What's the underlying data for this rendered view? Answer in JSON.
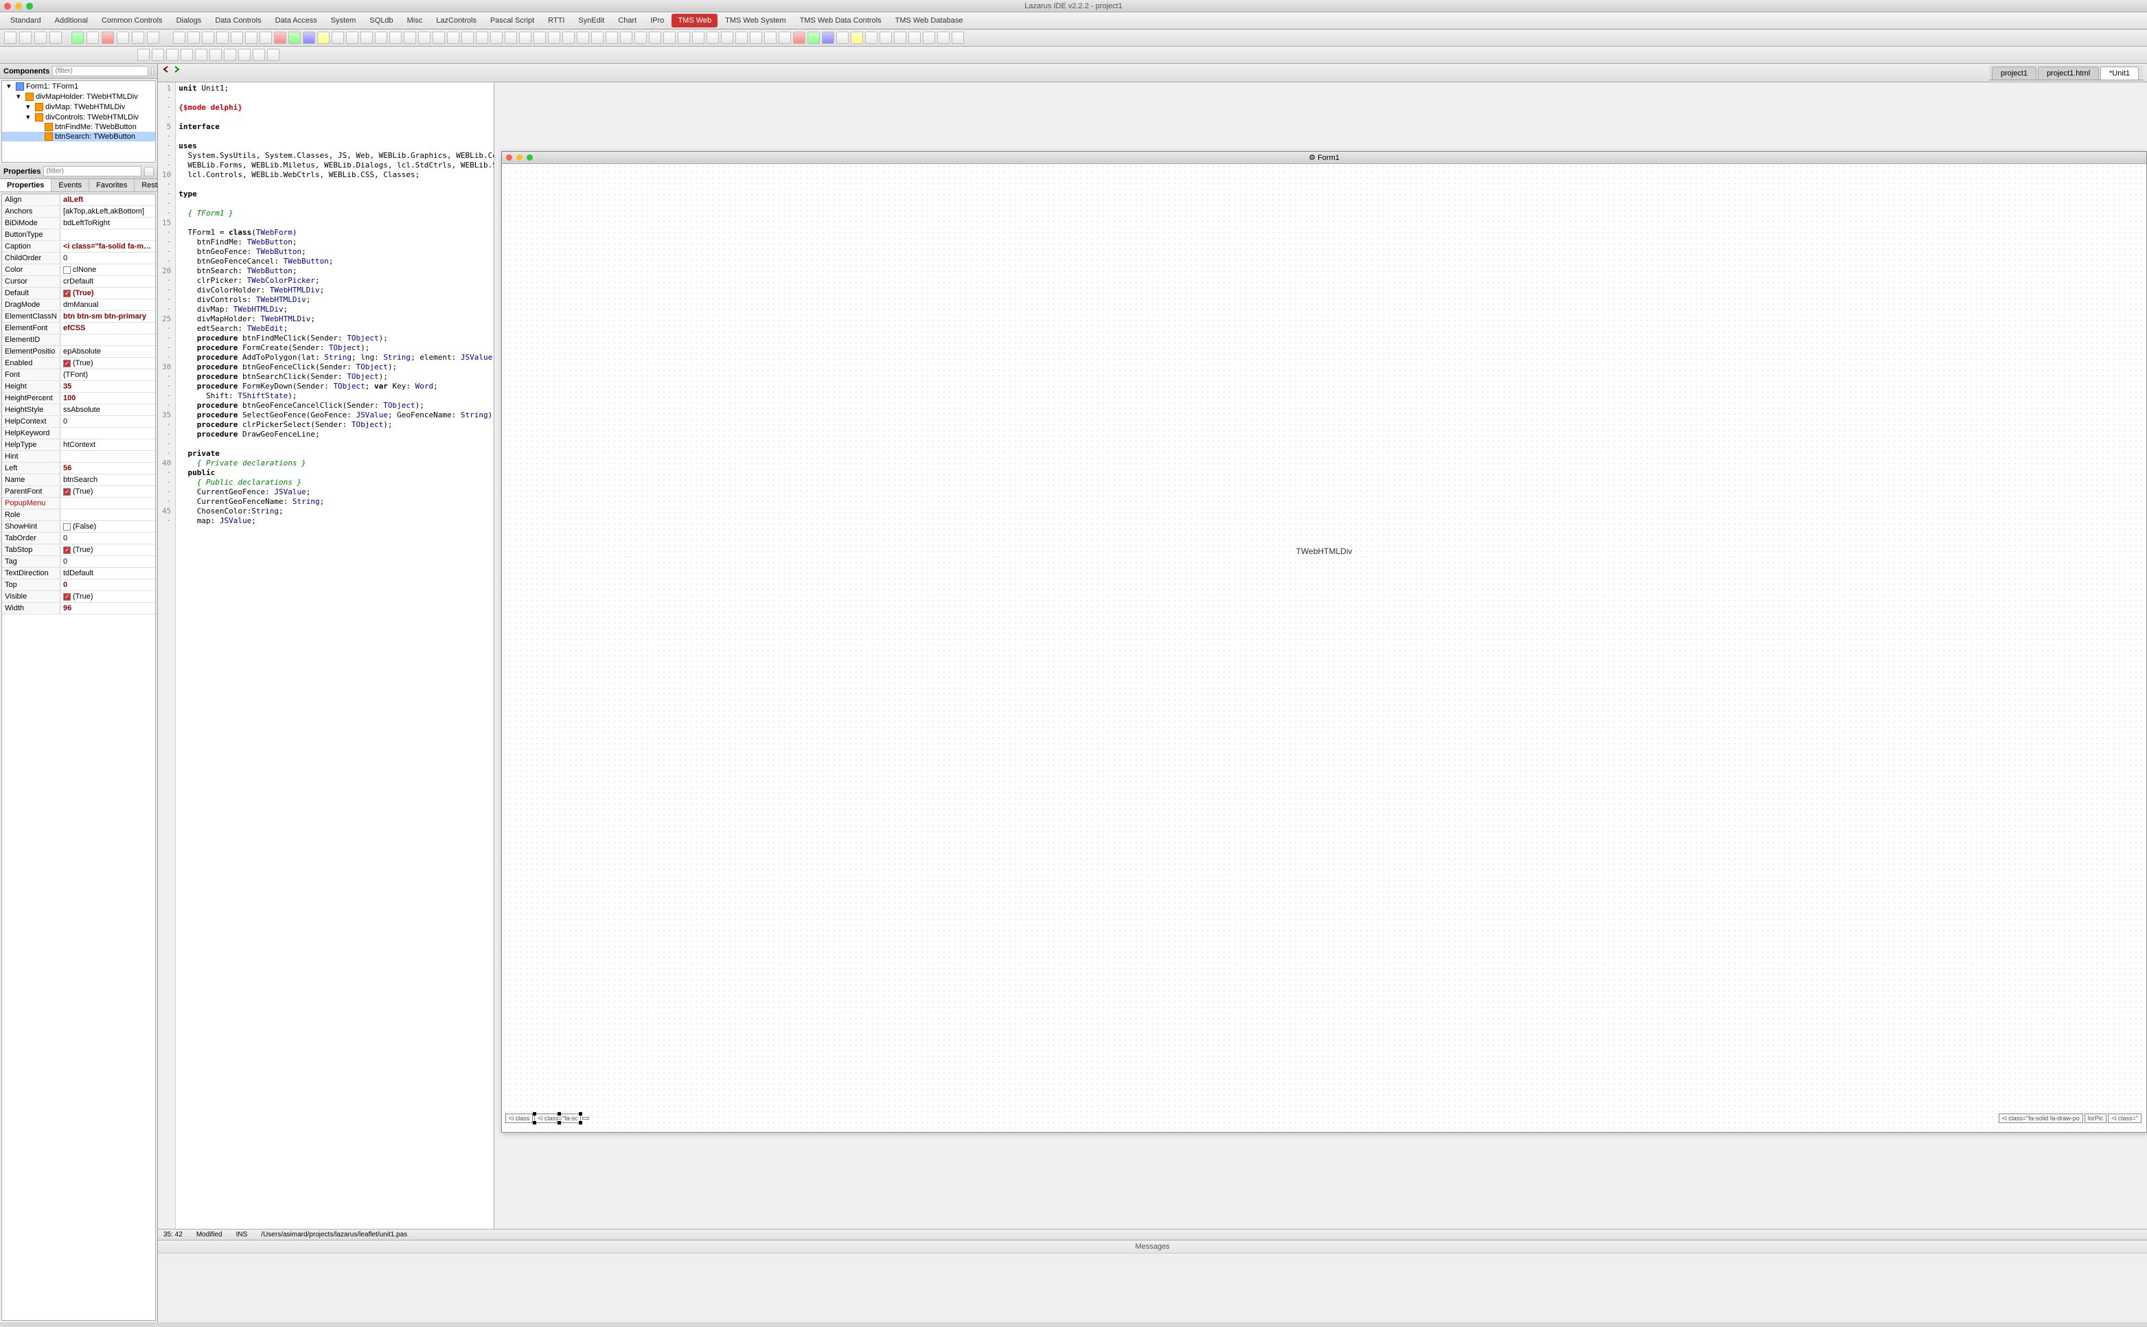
{
  "app": {
    "title": "Lazarus IDE v2.2.2 - project1"
  },
  "componentTabs": [
    "Standard",
    "Additional",
    "Common Controls",
    "Dialogs",
    "Data Controls",
    "Data Access",
    "System",
    "SQLdb",
    "Misc",
    "LazControls",
    "Pascal Script",
    "RTTI",
    "SynEdit",
    "Chart",
    "IPro",
    "TMS Web",
    "TMS Web System",
    "TMS Web Data Controls",
    "TMS Web Database"
  ],
  "componentTabActive": "TMS Web",
  "componentsPanel": {
    "title": "Components",
    "filterPlaceholder": "(filter)",
    "tree": [
      {
        "indent": 0,
        "label": "Form1: TForm1",
        "icon": "form"
      },
      {
        "indent": 1,
        "label": "divMapHolder: TWebHTMLDiv",
        "icon": "comp"
      },
      {
        "indent": 2,
        "label": "divMap: TWebHTMLDiv",
        "icon": "comp"
      },
      {
        "indent": 2,
        "label": "divControls: TWebHTMLDiv",
        "icon": "comp"
      },
      {
        "indent": 3,
        "label": "btnFindMe: TWebButton",
        "icon": "comp"
      },
      {
        "indent": 3,
        "label": "btnSearch: TWebButton",
        "icon": "comp",
        "selected": true
      }
    ]
  },
  "propertiesPanel": {
    "title": "Properties",
    "filterPlaceholder": "(filter)",
    "tabs": [
      "Properties",
      "Events",
      "Favorites",
      "Restricted"
    ],
    "activeTab": "Properties",
    "rows": [
      {
        "name": "Align",
        "value": "alLeft",
        "bold": true
      },
      {
        "name": "Anchors",
        "value": "[akTop,akLeft,akBottom]"
      },
      {
        "name": "BiDiMode",
        "value": "bdLeftToRight"
      },
      {
        "name": "ButtonType",
        "value": ""
      },
      {
        "name": "Caption",
        "value": "<i class=\"fa-solid fa-magnifyir",
        "bold": true
      },
      {
        "name": "ChildOrder",
        "value": "0"
      },
      {
        "name": "Color",
        "value": "clNone",
        "check": false
      },
      {
        "name": "Cursor",
        "value": "crDefault"
      },
      {
        "name": "Default",
        "value": "(True)",
        "check": true,
        "bold": true
      },
      {
        "name": "DragMode",
        "value": "dmManual"
      },
      {
        "name": "ElementClassN",
        "value": "btn btn-sm btn-primary",
        "bold": true
      },
      {
        "name": "ElementFont",
        "value": "efCSS",
        "bold": true
      },
      {
        "name": "ElementID",
        "value": ""
      },
      {
        "name": "ElementPositio",
        "value": "epAbsolute"
      },
      {
        "name": "Enabled",
        "value": "(True)",
        "check": true
      },
      {
        "name": "Font",
        "value": "(TFont)"
      },
      {
        "name": "Height",
        "value": "35",
        "bold": true
      },
      {
        "name": "HeightPercent",
        "value": "100",
        "bold": true
      },
      {
        "name": "HeightStyle",
        "value": "ssAbsolute"
      },
      {
        "name": "HelpContext",
        "value": "0"
      },
      {
        "name": "HelpKeyword",
        "value": ""
      },
      {
        "name": "HelpType",
        "value": "htContext"
      },
      {
        "name": "Hint",
        "value": ""
      },
      {
        "name": "Left",
        "value": "56",
        "bold": true
      },
      {
        "name": "Name",
        "value": "btnSearch"
      },
      {
        "name": "ParentFont",
        "value": "(True)",
        "check": true
      },
      {
        "name": "PopupMenu",
        "value": "",
        "red": true
      },
      {
        "name": "Role",
        "value": ""
      },
      {
        "name": "ShowHint",
        "value": "(False)",
        "check": false
      },
      {
        "name": "TabOrder",
        "value": "0"
      },
      {
        "name": "TabStop",
        "value": "(True)",
        "check": true
      },
      {
        "name": "Tag",
        "value": "0"
      },
      {
        "name": "TextDirection",
        "value": "tdDefault"
      },
      {
        "name": "Top",
        "value": "0",
        "bold": true
      },
      {
        "name": "Visible",
        "value": "(True)",
        "check": true
      },
      {
        "name": "Width",
        "value": "96",
        "bold": true
      }
    ]
  },
  "fileTabs": [
    "project1",
    "project1.html",
    "*Unit1"
  ],
  "activeFileTab": "*Unit1",
  "code": {
    "lines": [
      {
        "n": 1,
        "t": "unit Unit1;",
        "cls": ""
      },
      {
        "n": "·",
        "t": "",
        "cls": ""
      },
      {
        "n": "·",
        "t": "{$mode delphi}",
        "cls": "dir"
      },
      {
        "n": "·",
        "t": "",
        "cls": ""
      },
      {
        "n": 5,
        "t": "interface",
        "cls": "kw"
      },
      {
        "n": "·",
        "t": "",
        "cls": ""
      },
      {
        "n": "·",
        "t": "uses",
        "cls": "kw"
      },
      {
        "n": "·",
        "t": "  System.SysUtils, System.Classes, JS, Web, WEBLib.Graphics, WEBLib.Controls,",
        "cls": ""
      },
      {
        "n": "·",
        "t": "  WEBLib.Forms, WEBLib.Miletus, WEBLib.Dialogs, lcl.StdCtrls, WEBLib.StdCtrls,",
        "cls": ""
      },
      {
        "n": 10,
        "t": "  lcl.Controls, WEBLib.WebCtrls, WEBLib.CSS, Classes;",
        "cls": ""
      },
      {
        "n": "·",
        "t": "",
        "cls": ""
      },
      {
        "n": "·",
        "t": "type",
        "cls": "kw"
      },
      {
        "n": "·",
        "t": "",
        "cls": ""
      },
      {
        "n": "·",
        "t": "  { TForm1 }",
        "cls": "cmt"
      },
      {
        "n": 15,
        "t": "",
        "cls": ""
      },
      {
        "n": "·",
        "t": "  TForm1 = class(TWebForm)",
        "cls": ""
      },
      {
        "n": "·",
        "t": "    btnFindMe: TWebButton;",
        "cls": ""
      },
      {
        "n": "·",
        "t": "    btnGeoFence: TWebButton;",
        "cls": ""
      },
      {
        "n": "·",
        "t": "    btnGeoFenceCancel: TWebButton;",
        "cls": ""
      },
      {
        "n": 20,
        "t": "    btnSearch: TWebButton;",
        "cls": ""
      },
      {
        "n": "·",
        "t": "    clrPicker: TWebColorPicker;",
        "cls": ""
      },
      {
        "n": "·",
        "t": "    divColorHolder: TWebHTMLDiv;",
        "cls": ""
      },
      {
        "n": "·",
        "t": "    divControls: TWebHTMLDiv;",
        "cls": ""
      },
      {
        "n": "·",
        "t": "    divMap: TWebHTMLDiv;",
        "cls": ""
      },
      {
        "n": 25,
        "t": "    divMapHolder: TWebHTMLDiv;",
        "cls": ""
      },
      {
        "n": "·",
        "t": "    edtSearch: TWebEdit;",
        "cls": ""
      },
      {
        "n": "·",
        "t": "    procedure btnFindMeClick(Sender: TObject);",
        "cls": ""
      },
      {
        "n": "·",
        "t": "    procedure FormCreate(Sender: TObject);",
        "cls": ""
      },
      {
        "n": "·",
        "t": "    procedure AddToPolygon(lat: String; lng: String; element: JSValue);",
        "cls": ""
      },
      {
        "n": 30,
        "t": "    procedure btnGeoFenceClick(Sender: TObject);",
        "cls": ""
      },
      {
        "n": "·",
        "t": "    procedure btnSearchClick(Sender: TObject);",
        "cls": ""
      },
      {
        "n": "·",
        "t": "    procedure FormKeyDown(Sender: TObject; var Key: Word;",
        "cls": ""
      },
      {
        "n": "·",
        "t": "      Shift: TShiftState);",
        "cls": ""
      },
      {
        "n": "·",
        "t": "    procedure btnGeoFenceCancelClick(Sender: TObject);",
        "cls": ""
      },
      {
        "n": 35,
        "t": "    procedure SelectGeoFence(GeoFence: JSValue; GeoFenceName: String);",
        "cls": ""
      },
      {
        "n": "·",
        "t": "    procedure clrPickerSelect(Sender: TObject);",
        "cls": ""
      },
      {
        "n": "·",
        "t": "    procedure DrawGeoFenceLine;",
        "cls": ""
      },
      {
        "n": "·",
        "t": "",
        "cls": ""
      },
      {
        "n": "·",
        "t": "  private",
        "cls": "kw"
      },
      {
        "n": 40,
        "t": "    { Private declarations }",
        "cls": "cmt"
      },
      {
        "n": "·",
        "t": "  public",
        "cls": "kw"
      },
      {
        "n": "·",
        "t": "    { Public declarations }",
        "cls": "cmt"
      },
      {
        "n": "·",
        "t": "    CurrentGeoFence: JSValue;",
        "cls": ""
      },
      {
        "n": "·",
        "t": "    CurrentGeoFenceName: String;",
        "cls": ""
      },
      {
        "n": 45,
        "t": "    ChosenColor:String;",
        "cls": ""
      },
      {
        "n": "·",
        "t": "    map: JSValue;",
        "cls": ""
      }
    ]
  },
  "statusBar": {
    "pos": "35: 42",
    "modified": "Modified",
    "ins": "INS",
    "path": "/Users/asimard/projects/lazarus/leaflet/unit1.pas"
  },
  "messages": {
    "title": "Messages"
  },
  "formDesigner": {
    "title": "Form1",
    "placeholder": "TWebHTMLDiv",
    "buttons": [
      "<i class",
      "<i class=\"fa-sc",
      "",
      "<i class=\"fa-solid fa-draw-po",
      "lorPic",
      "<i class=\""
    ]
  }
}
